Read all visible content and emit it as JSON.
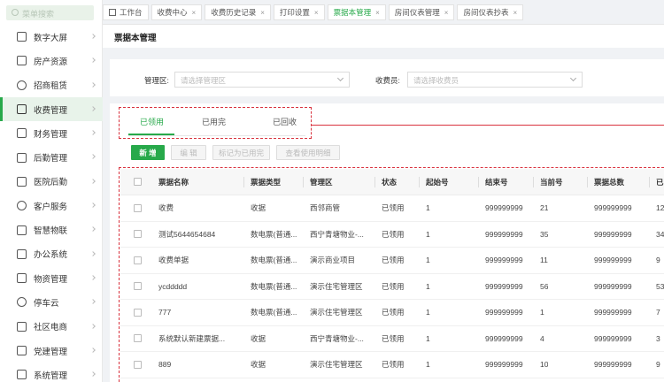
{
  "sidebar": {
    "search_placeholder": "菜单搜索",
    "items": [
      {
        "label": "数字大屏",
        "icon": "monitor-icon"
      },
      {
        "label": "房产资源",
        "icon": "building-icon"
      },
      {
        "label": "招商租赁",
        "icon": "house-icon"
      },
      {
        "label": "收费管理",
        "icon": "money-bag-icon",
        "active": true
      },
      {
        "label": "财务管理",
        "icon": "ledger-icon"
      },
      {
        "label": "后勤管理",
        "icon": "handshake-icon"
      },
      {
        "label": "医院后勤",
        "icon": "hospital-icon"
      },
      {
        "label": "客户服务",
        "icon": "user-icon"
      },
      {
        "label": "智慧物联",
        "icon": "iot-icon"
      },
      {
        "label": "办公系统",
        "icon": "layers-icon"
      },
      {
        "label": "物资管理",
        "icon": "box-icon"
      },
      {
        "label": "停车云",
        "icon": "parking-icon"
      },
      {
        "label": "社区电商",
        "icon": "shop-icon"
      },
      {
        "label": "党建管理",
        "icon": "flag-icon"
      },
      {
        "label": "系统管理",
        "icon": "gear-icon"
      }
    ]
  },
  "tabs": [
    {
      "label": "工作台",
      "closable": false
    },
    {
      "label": "收费中心",
      "closable": true
    },
    {
      "label": "收费历史记录",
      "closable": true
    },
    {
      "label": "打印设置",
      "closable": true
    },
    {
      "label": "票据本管理",
      "closable": true,
      "active": true
    },
    {
      "label": "房间仪表管理",
      "closable": true
    },
    {
      "label": "房间仪表抄表",
      "closable": true
    }
  ],
  "page_title": "票据本管理",
  "filters": {
    "area_label": "管理区:",
    "area_placeholder": "请选择管理区",
    "collector_label": "收费员:",
    "collector_placeholder": "请选择收费员"
  },
  "status_tabs": [
    "已领用",
    "已用完",
    "已回收"
  ],
  "buttons": {
    "add": "新 增",
    "edit": "编 辑",
    "mark_used": "标记为已用完",
    "view_detail": "查看使用明细"
  },
  "table": {
    "columns": [
      "票据名称",
      "票据类型",
      "管理区",
      "状态",
      "起始号",
      "结束号",
      "当前号",
      "票据总数",
      "已"
    ],
    "rows": [
      [
        "收费",
        "收据",
        "西邻商管",
        "已领用",
        "1",
        "999999999",
        "21",
        "999999999",
        "12"
      ],
      [
        "测试5644654684",
        "数电票(普通...",
        "西宁青塘物业-...",
        "已领用",
        "1",
        "999999999",
        "35",
        "999999999",
        "34"
      ],
      [
        "收费单据",
        "数电票(普通...",
        "演示商业项目",
        "已领用",
        "1",
        "999999999",
        "11",
        "999999999",
        "9"
      ],
      [
        "ycddddd",
        "数电票(普通...",
        "演示住宅管理区",
        "已领用",
        "1",
        "999999999",
        "56",
        "999999999",
        "53"
      ],
      [
        "777",
        "数电票(普通...",
        "演示住宅管理区",
        "已领用",
        "1",
        "999999999",
        "1",
        "999999999",
        "7"
      ],
      [
        "系统默认新建票据...",
        "收据",
        "西宁青塘物业-...",
        "已领用",
        "1",
        "999999999",
        "4",
        "999999999",
        "3"
      ],
      [
        "889",
        "收据",
        "演示住宅管理区",
        "已领用",
        "1",
        "999999999",
        "10",
        "999999999",
        "9"
      ]
    ]
  },
  "colors": {
    "accent": "#27a94a",
    "annotation": "#d9333f"
  }
}
